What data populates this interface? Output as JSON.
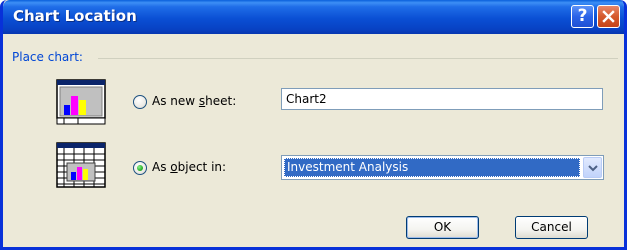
{
  "window": {
    "title": "Chart Location",
    "help_glyph": "?",
    "close_icon": "close-x-icon"
  },
  "group": {
    "label": "Place chart:"
  },
  "option_new_sheet": {
    "label_pre": "As new ",
    "label_accel": "s",
    "label_post": "heet:",
    "selected": false,
    "value": "Chart2",
    "icon": "chart-sheet-icon"
  },
  "option_object_in": {
    "label_pre": "As ",
    "label_accel": "o",
    "label_post": "bject in:",
    "selected": true,
    "value": "Investment Analysis",
    "icon": "embedded-chart-worksheet-icon",
    "dropdown_icon": "chevron-down-icon"
  },
  "buttons": {
    "ok": "OK",
    "cancel": "Cancel"
  },
  "colors": {
    "title_bar": "#0a4fd4",
    "dialog_bg": "#ece9d8",
    "group_label": "#0046d5",
    "selection": "#316ac5"
  }
}
